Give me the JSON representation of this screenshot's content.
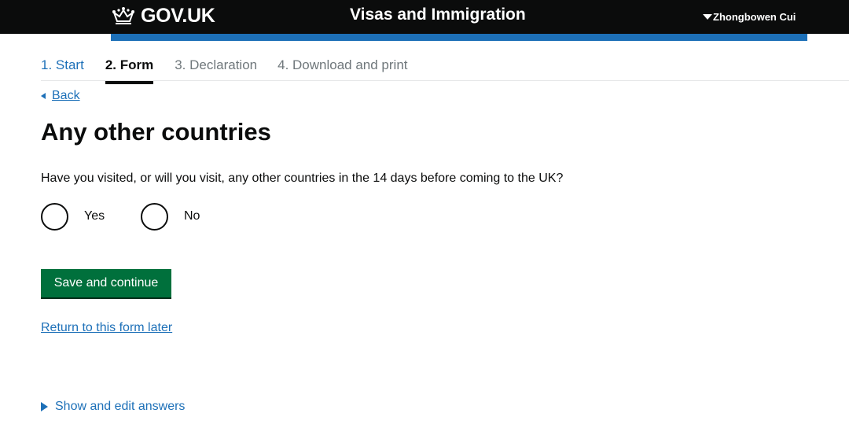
{
  "header": {
    "logo_text": "GOV.UK",
    "service_name": "Visas and Immigration",
    "user_name": "Zhongbowen Cui"
  },
  "steps": [
    {
      "label": "1. Start",
      "state": "completed"
    },
    {
      "label": "2. Form",
      "state": "current"
    },
    {
      "label": "3. Declaration",
      "state": "upcoming"
    },
    {
      "label": "4. Download and print",
      "state": "upcoming"
    }
  ],
  "back_link": "Back",
  "page_title": "Any other countries",
  "question": "Have you visited, or will you visit, any other countries in the 14 days before coming to the UK?",
  "options": [
    {
      "label": "Yes",
      "selected": false
    },
    {
      "label": "No",
      "selected": false
    }
  ],
  "save_button": "Save and continue",
  "return_link": "Return to this form later",
  "details_summary": "Show and edit answers",
  "colors": {
    "header_bg": "#0b0c0c",
    "accent_bar": "#1d70b8",
    "link": "#1d70b8",
    "button": "#00703c"
  },
  "icons": {
    "logo": "crown-icon",
    "user_menu": "caret-down-icon",
    "back": "triangle-left-icon",
    "details": "triangle-right-icon"
  }
}
